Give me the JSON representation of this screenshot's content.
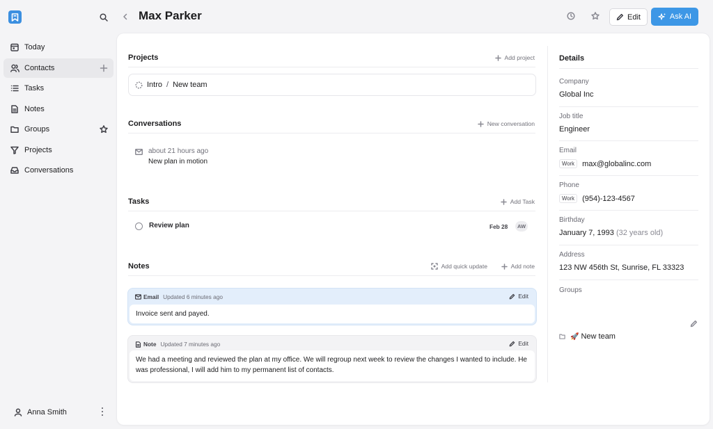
{
  "app": {
    "accent": "#3d97e6"
  },
  "sidebar": {
    "items": [
      {
        "label": "Today",
        "icon": "calendar-icon",
        "active": false
      },
      {
        "label": "Contacts",
        "icon": "users-icon",
        "active": true,
        "trail": "plus-icon"
      },
      {
        "label": "Tasks",
        "icon": "list-icon",
        "active": false
      },
      {
        "label": "Notes",
        "icon": "document-icon",
        "active": false
      },
      {
        "label": "Groups",
        "icon": "folder-icon",
        "active": false,
        "trail": "star-icon"
      },
      {
        "label": "Projects",
        "icon": "filter-icon",
        "active": false
      },
      {
        "label": "Conversations",
        "icon": "inbox-icon",
        "active": false
      }
    ],
    "user": {
      "name": "Anna Smith"
    }
  },
  "header": {
    "title": "Max Parker",
    "edit_label": "Edit",
    "ask_ai_label": "Ask AI"
  },
  "projects": {
    "title": "Projects",
    "action": "Add project",
    "items": [
      {
        "stage": "Intro",
        "separator": "/",
        "name": "New team"
      }
    ]
  },
  "conversations": {
    "title": "Conversations",
    "action": "New conversation",
    "items": [
      {
        "time": "about 21 hours ago",
        "title": "New plan in motion"
      }
    ]
  },
  "tasks": {
    "title": "Tasks",
    "action": "Add Task",
    "items": [
      {
        "title": "Review plan",
        "due": "Feb 28",
        "assignee": "AW"
      }
    ]
  },
  "notes": {
    "title": "Notes",
    "quick_update": "Add quick update",
    "add_note": "Add note",
    "items": [
      {
        "kind": "Email",
        "updated": "Updated 6 minutes ago",
        "edit": "Edit",
        "body": "Invoice sent and payed."
      },
      {
        "kind": "Note",
        "updated": "Updated 7 minutes ago",
        "edit": "Edit",
        "body": "We had a meeting and reviewed the plan at my office. We will regroup next week to review the changes I wanted to include. He was professional, I will add him to my permanent list of contacts."
      }
    ]
  },
  "details": {
    "title": "Details",
    "company": {
      "label": "Company",
      "value": "Global Inc"
    },
    "job": {
      "label": "Job title",
      "value": "Engineer"
    },
    "email": {
      "label": "Email",
      "tag": "Work",
      "value": "max@globalinc.com"
    },
    "phone": {
      "label": "Phone",
      "tag": "Work",
      "value": "(954)-123-4567"
    },
    "birthday": {
      "label": "Birthday",
      "value": "January 7, 1993",
      "age": "(32 years old)"
    },
    "address": {
      "label": "Address",
      "value": "123 NW 456th St, Sunrise, FL 33323"
    },
    "groups": {
      "label": "Groups",
      "items": [
        {
          "name": "New team",
          "emoji": "🚀"
        }
      ]
    }
  }
}
